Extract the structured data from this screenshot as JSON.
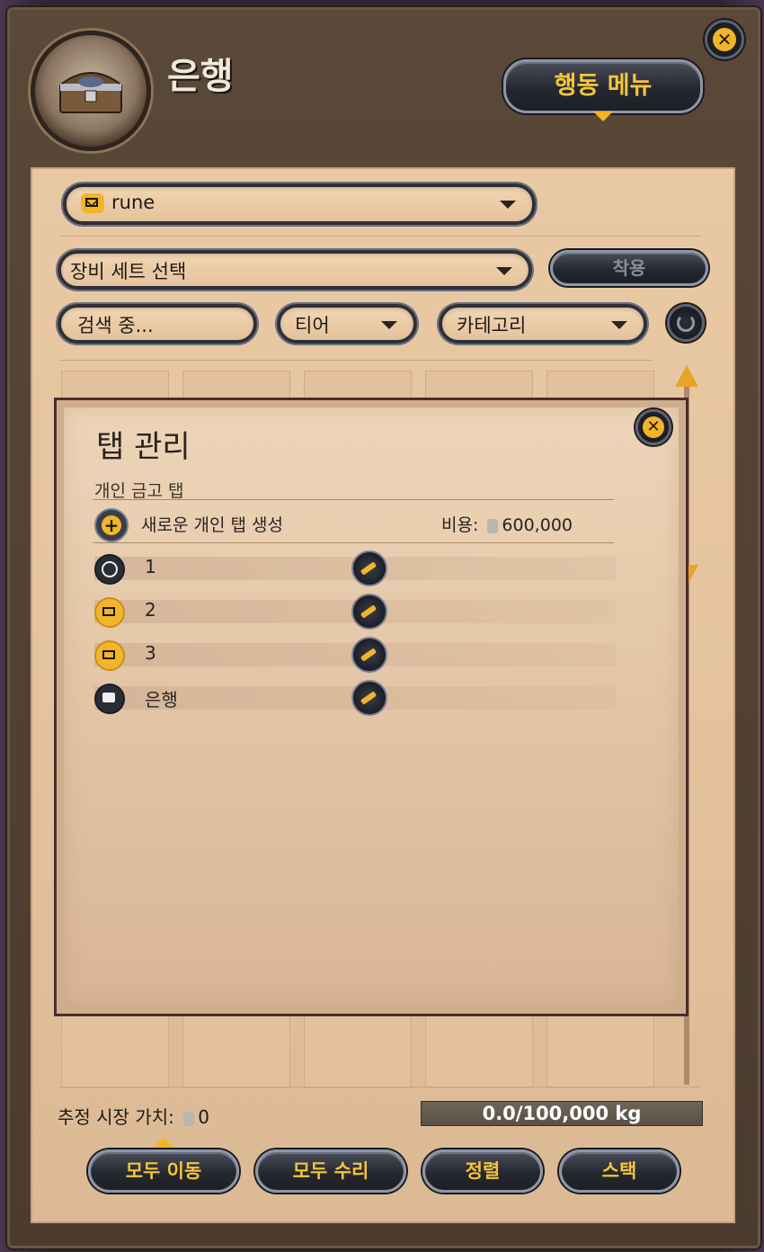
{
  "window": {
    "title": "은행",
    "action_menu_label": "행동 메뉴"
  },
  "filters": {
    "tab_dropdown_value": "rune",
    "equipment_set_value": "장비 세트 선택",
    "apply_label": "착용",
    "search_placeholder": "검색 중...",
    "tier_label": "티어",
    "category_label": "카테고리"
  },
  "modal": {
    "title": "탭 관리",
    "section_label": "개인 금고 탭",
    "create_label": "새로운 개인 탭 생성",
    "cost_label": "비용:",
    "cost_value": "600,000",
    "tabs": [
      {
        "name": "1",
        "icon": "target-icon"
      },
      {
        "name": "2",
        "icon": "envelope-icon"
      },
      {
        "name": "3",
        "icon": "envelope-icon"
      },
      {
        "name": "은행",
        "icon": "chest-icon"
      }
    ]
  },
  "footer": {
    "market_value_label": "추정 시장 가치:",
    "market_value": "0",
    "weight": "0.0/100,000 kg",
    "buttons": {
      "move_all": "모두 이동",
      "repair_all": "모두 수리",
      "sort": "정렬",
      "stack": "스택"
    }
  },
  "colors": {
    "accent": "#f2b52a",
    "paper": "#e6c6a0",
    "frame": "#4b3b2e"
  }
}
